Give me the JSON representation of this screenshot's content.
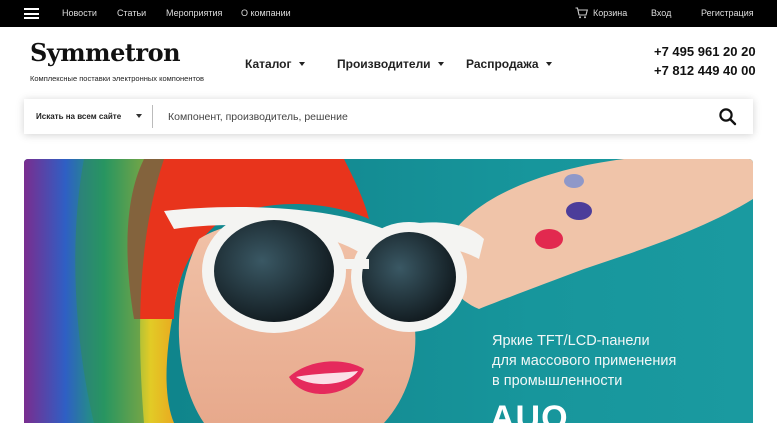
{
  "topbar": {
    "menu_icon": "hamburger-icon",
    "links": [
      "Новости",
      "Статьи",
      "Мероприятия",
      "О компании"
    ],
    "cart_icon": "cart-icon",
    "cart_label": "Корзина",
    "login_label": "Вход",
    "register_label": "Регистрация"
  },
  "header": {
    "logo": "Symmetron",
    "tagline": "Комплексные поставки электронных компонентов",
    "nav": [
      "Каталог",
      "Производители",
      "Распродажа"
    ],
    "phones": [
      "+7 495 961 20 20",
      "+7 812 449 40 00"
    ]
  },
  "search": {
    "scope": "Искать на всем сайте",
    "placeholder": "Компонент, производитель, решение",
    "button_icon": "search-icon"
  },
  "banner": {
    "lines": [
      "Яркие TFT/LCD-панели",
      "для массового применения",
      "в промышленности"
    ],
    "brand": "AUO",
    "colors": {
      "background": "#148c93",
      "text": "#f2f7f7"
    }
  },
  "colors": {
    "topbar": "#000000",
    "accent": "#148c93"
  }
}
